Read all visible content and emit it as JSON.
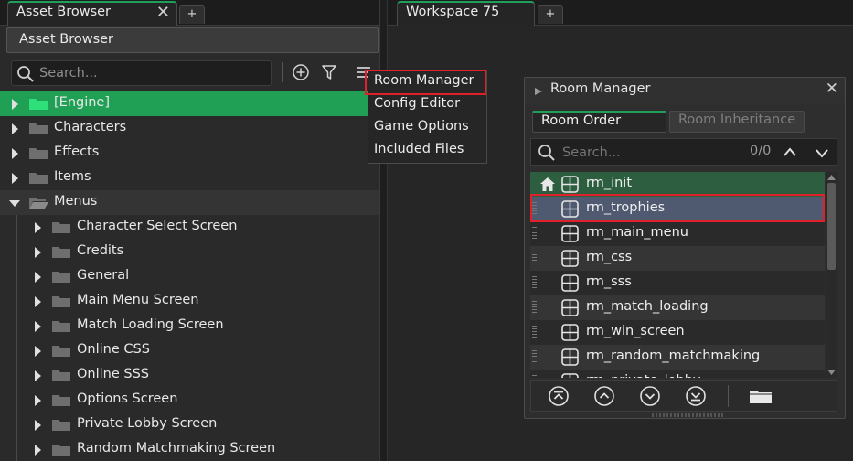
{
  "tabs": {
    "left": {
      "label": "Asset Browser",
      "close": "✕",
      "add": "+"
    },
    "right": {
      "label": "Workspace 75",
      "add": "+"
    }
  },
  "asset_browser": {
    "header": "Asset Browser",
    "search_placeholder": "Search...",
    "tree": [
      {
        "label": "[Engine]",
        "depth": 0,
        "expanded": false,
        "selected": true
      },
      {
        "label": "Characters",
        "depth": 0,
        "expanded": false
      },
      {
        "label": "Effects",
        "depth": 0,
        "expanded": false
      },
      {
        "label": "Items",
        "depth": 0,
        "expanded": false
      },
      {
        "label": "Menus",
        "depth": 0,
        "expanded": true
      },
      {
        "label": "Character Select Screen",
        "depth": 1,
        "expanded": false
      },
      {
        "label": "Credits",
        "depth": 1,
        "expanded": false
      },
      {
        "label": "General",
        "depth": 1,
        "expanded": false
      },
      {
        "label": "Main Menu Screen",
        "depth": 1,
        "expanded": false
      },
      {
        "label": "Match Loading Screen",
        "depth": 1,
        "expanded": false
      },
      {
        "label": "Online CSS",
        "depth": 1,
        "expanded": false
      },
      {
        "label": "Online SSS",
        "depth": 1,
        "expanded": false
      },
      {
        "label": "Options Screen",
        "depth": 1,
        "expanded": false
      },
      {
        "label": "Private Lobby Screen",
        "depth": 1,
        "expanded": false
      },
      {
        "label": "Random Matchmaking Screen",
        "depth": 1,
        "expanded": false
      }
    ]
  },
  "context_menu": {
    "items": [
      "Room Manager",
      "Config Editor",
      "Game Options",
      "Included Files"
    ],
    "highlighted": "Room Manager"
  },
  "room_manager": {
    "title": "Room Manager",
    "close": "✕",
    "tabs": [
      {
        "label": "Room Order",
        "active": true
      },
      {
        "label": "Room Inheritance",
        "active": false
      }
    ],
    "search_placeholder": "Search...",
    "match_count": "0/0",
    "rooms": [
      "rm_init",
      "rm_trophies",
      "rm_main_menu",
      "rm_css",
      "rm_sss",
      "rm_match_loading",
      "rm_win_screen",
      "rm_random_matchmaking",
      "rm_private_lobby"
    ],
    "start_room": "rm_init",
    "selected_room": "rm_trophies"
  },
  "colors": {
    "accent_green": "#1fa055",
    "highlight_red": "#e0212b",
    "selected_room": "#4f5a70",
    "start_room": "#2d5e40"
  },
  "icons": [
    "search-icon",
    "add-circle-icon",
    "filter-icon",
    "menu-icon",
    "folder-icon",
    "home-icon",
    "room-icon",
    "move-top-icon",
    "move-up-icon",
    "move-down-icon",
    "move-bottom-icon",
    "folder-add-icon",
    "chevron-up-icon",
    "chevron-down-icon"
  ]
}
